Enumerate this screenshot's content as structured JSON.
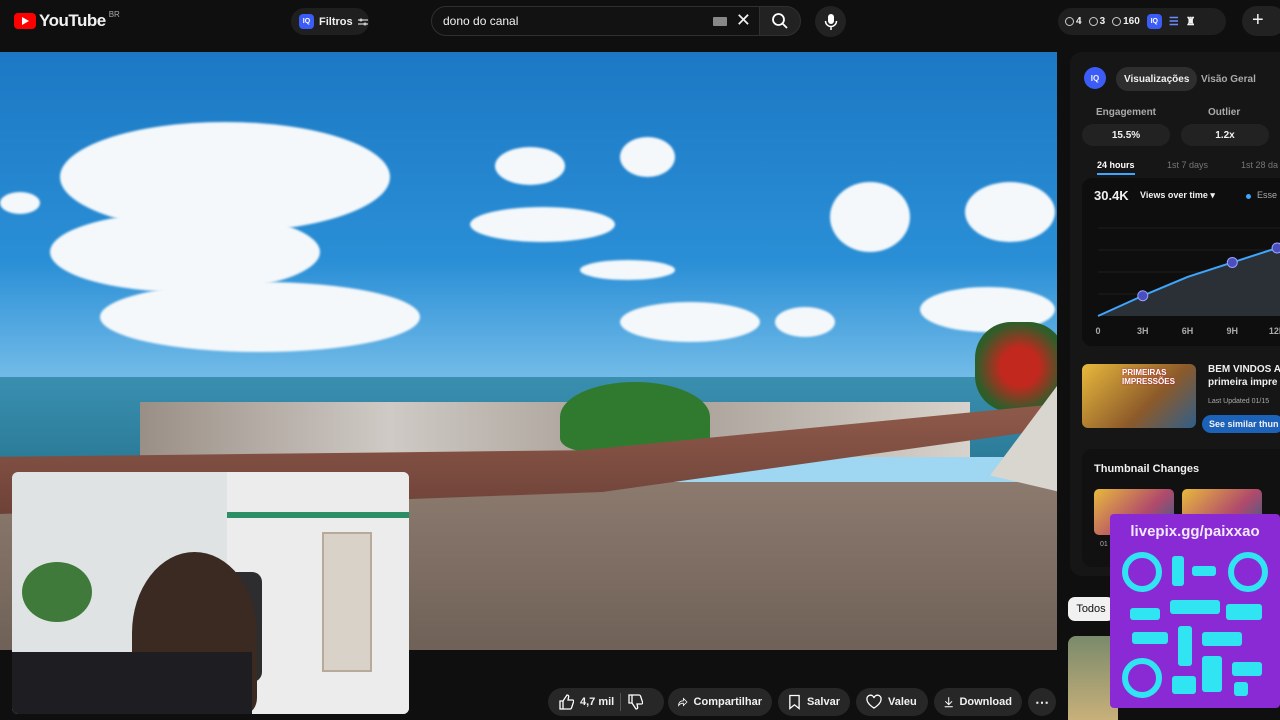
{
  "header": {
    "logo": "YouTube",
    "country": "BR",
    "filters_label": "Filtros",
    "search_value": "dono do canal",
    "stat1": "4",
    "stat2": "3",
    "stat3": "160",
    "iq_badge": "IQ"
  },
  "actions": {
    "likes": "4,7 mil",
    "share": "Compartilhar",
    "save": "Salvar",
    "thanks": "Valeu",
    "download": "Download"
  },
  "sidebar": {
    "tabs": [
      "Visualizações",
      "Visão Geral"
    ],
    "engagement_label": "Engagement",
    "engagement_value": "15.5%",
    "outlier_label": "Outlier",
    "outlier_value": "1.2x",
    "time_tabs": [
      "24 hours",
      "1st 7 days",
      "1st 28 da"
    ],
    "views_total": "30.4K",
    "views_dropdown": "Views over time ▾",
    "legend": "Esse",
    "x_ticks": [
      "0",
      "3H",
      "6H",
      "9H",
      "12H"
    ],
    "video_title_1": "BEM VINDOS A",
    "video_title_2": "primeira impre",
    "updated": "Last Updated 01/15",
    "similar_btn": "See similar thun",
    "thumb_text": "PRIMEIRAS IMPRESSÕES",
    "thumb_changes": "Thumbnail Changes",
    "thumb_date": "01",
    "filter_all": "Todos"
  },
  "chart_data": {
    "type": "line",
    "x": [
      0,
      3,
      6,
      9,
      12,
      13
    ],
    "values": [
      0,
      7,
      13.5,
      18.5,
      23.5,
      30.4
    ],
    "ylabel": "",
    "xlabel": "",
    "x_ticks": [
      "0",
      "3H",
      "6H",
      "9H",
      "12H"
    ]
  },
  "overlay": {
    "livepix": "livepix.gg/paixxao"
  },
  "colors": {
    "accent": "#3ea6ff",
    "brand": "#ff0000",
    "livepix": "#8a2ad4",
    "qr": "#31e4f2"
  }
}
